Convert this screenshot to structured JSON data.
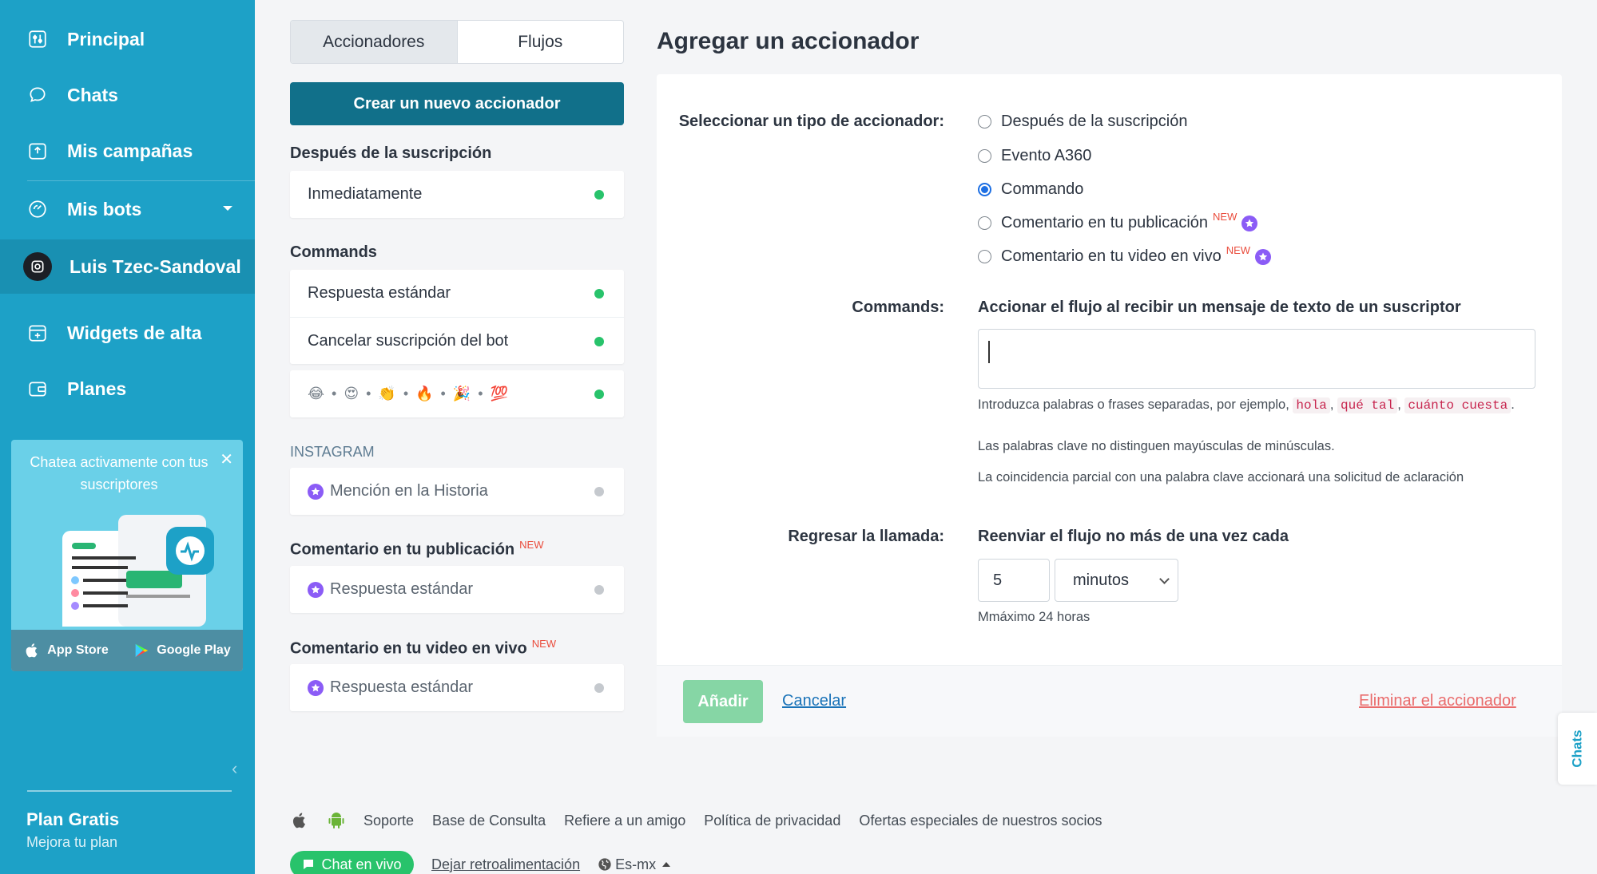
{
  "sidebar": {
    "items": [
      {
        "label": "Principal",
        "icon": "sliders-icon"
      },
      {
        "label": "Chats",
        "icon": "chat-bubble-icon"
      },
      {
        "label": "Mis campañas",
        "icon": "campaign-icon"
      },
      {
        "label": "Mis bots",
        "icon": "bot-icon"
      },
      {
        "label": "Luis Tzec-Sandoval",
        "icon": "instagram-icon"
      },
      {
        "label": "Widgets de alta",
        "icon": "widget-icon"
      },
      {
        "label": "Planes",
        "icon": "wallet-icon"
      }
    ],
    "promo": {
      "text": "Chatea activamente con tus suscriptores",
      "app_store": "App Store",
      "google_play": "Google Play"
    },
    "plan": {
      "title": "Plan Gratis",
      "subtitle": "Mejora tu plan"
    }
  },
  "tabs": [
    {
      "label": "Accionadores"
    },
    {
      "label": "Flujos"
    }
  ],
  "create_button": "Crear un nuevo accionador",
  "sections": {
    "subscription": {
      "title": "Después de la suscripción",
      "items": [
        "Inmediatamente"
      ]
    },
    "commands": {
      "title": "Commands",
      "items": [
        "Respuesta estándar",
        "Cancelar suscripción del bot"
      ],
      "emoji_row": "😂 • 😍 • 👏 • 🔥 • 🎉 • 💯"
    },
    "instagram": {
      "title": "INSTAGRAM",
      "items": [
        "Mención en la Historia"
      ]
    },
    "post_comment": {
      "title": "Comentario en tu publicación",
      "badge": "NEW",
      "items": [
        "Respuesta estándar"
      ]
    },
    "live_comment": {
      "title": "Comentario en tu video en vivo",
      "badge": "NEW",
      "items": [
        "Respuesta estándar"
      ]
    }
  },
  "panel": {
    "title": "Agregar un accionador",
    "type_label": "Seleccionar un tipo de accionador:",
    "types": [
      {
        "label": "Después de la suscripción",
        "selected": false
      },
      {
        "label": "Evento A360",
        "selected": false
      },
      {
        "label": "Commando",
        "selected": true
      },
      {
        "label": "Comentario en tu publicación",
        "badge": "NEW",
        "selected": false
      },
      {
        "label": "Comentario en tu video en vivo",
        "badge": "NEW",
        "selected": false
      }
    ],
    "commands_label": "Commands:",
    "commands_desc": "Accionar el flujo al recibir un mensaje de texto de un suscriptor",
    "commands_value": "",
    "help_prefix": "Introduzca palabras o frases separadas, por ejemplo,",
    "keywords": [
      "hola",
      "qué tal",
      "cuánto cuesta"
    ],
    "help_case": "Las palabras clave no distinguen mayúsculas de minúsculas.",
    "help_partial": "La coincidencia parcial con una palabra clave accionará una solicitud de aclaración",
    "callback_label": "Regresar la llamada:",
    "callback_desc": "Reenviar el flujo no más de una vez cada",
    "callback_value": "5",
    "callback_unit": "minutos",
    "callback_max": "Mmáximo 24 horas",
    "add_button": "Añadir",
    "cancel_link": "Cancelar",
    "delete_link": "Eliminar el accionador"
  },
  "chats_tab": "Chats",
  "footer": {
    "links": [
      "Soporte",
      "Base de Consulta",
      "Refiere a un amigo",
      "Política de privacidad",
      "Ofertas especiales de nuestros socios"
    ],
    "live_chat": "Chat en vivo",
    "feedback": "Dejar retroalimentación",
    "language": "Es-mx"
  },
  "colors": {
    "sidebar": "#1da1c7",
    "primary_dark": "#11708a",
    "success": "#28c36b",
    "new_badge": "#ea4c3c",
    "pro_star": "#8b5cf6"
  }
}
